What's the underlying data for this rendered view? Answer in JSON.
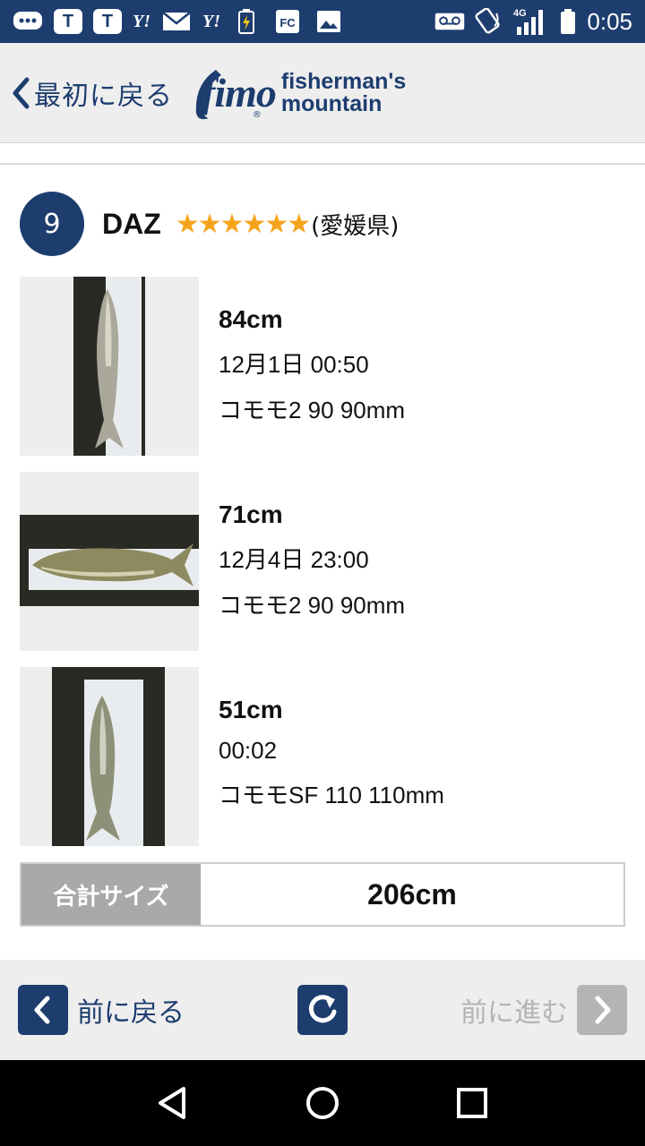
{
  "status_bar": {
    "time": "0:05",
    "network": "4G",
    "icons": [
      "chat-icon",
      "t-app-icon",
      "t-app-icon",
      "yahoo-icon",
      "mail-icon",
      "yahoo-icon",
      "battery-charging-icon",
      "fc-icon",
      "image-icon",
      "voicemail-icon",
      "nfc-icon",
      "signal-icon",
      "battery-icon"
    ]
  },
  "header": {
    "back_label": "最初に戻る",
    "logo_fimo": "fimo",
    "logo_line1": "fisherman's",
    "logo_line2": "mountain",
    "logo_reg": "®"
  },
  "entry": {
    "rank": "9",
    "angler": "DAZ",
    "stars": "★★★★★★",
    "prefecture": "(愛媛県)",
    "catches": [
      {
        "size": "84cm",
        "when": "12月1日 00:50",
        "lure": "コモモ2 90 90mm"
      },
      {
        "size": "71cm",
        "when": "12月4日 23:00",
        "lure": "コモモ2 90 90mm"
      },
      {
        "size": "51cm",
        "when": "00:02",
        "lure": "コモモSF 110 110mm"
      }
    ],
    "total_label": "合計サイズ",
    "total_value": "206cm"
  },
  "pager": {
    "prev_label": "前に戻る",
    "next_label": "前に進む"
  },
  "colors": {
    "brand": "#1d3d6f",
    "star": "#f5a31a",
    "disabled": "#b4b4b4"
  }
}
